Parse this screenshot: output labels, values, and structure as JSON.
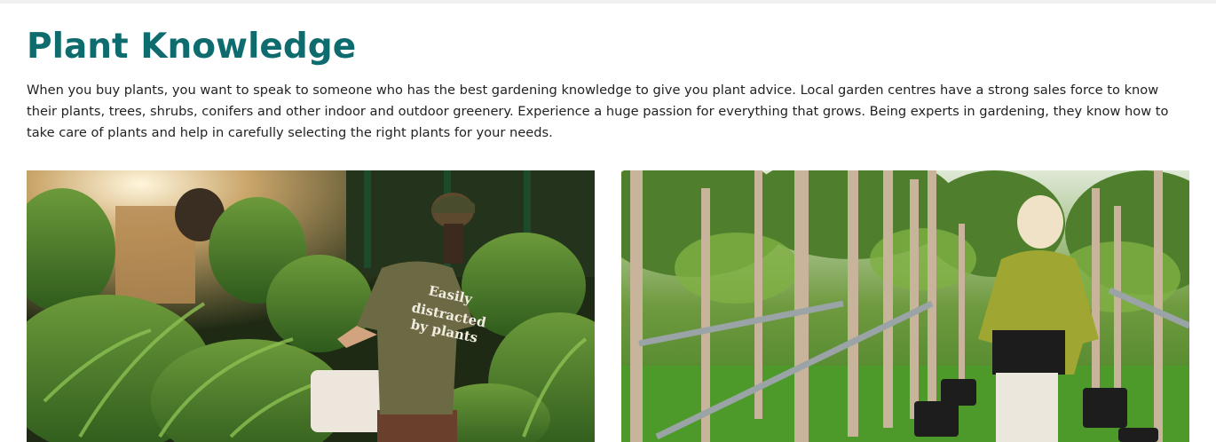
{
  "section": {
    "title": "Plant Knowledge",
    "intro": "When you buy plants, you want to speak to someone who has the best gardening knowledge to give you plant advice. Local garden centres have a strong sales force to know their plants, trees, shrubs, conifers and other indoor and outdoor greenery. Experience a huge passion for everything that grows. Being experts in gardening, they know how to take care of plants and help in carefully selecting the right plants for your needs."
  },
  "photos": {
    "left": {
      "shirt_text": [
        "Easily",
        "distracted",
        "by plants"
      ]
    },
    "right": {}
  },
  "colors": {
    "title": "#0e6b6e",
    "body_text": "#222222"
  }
}
